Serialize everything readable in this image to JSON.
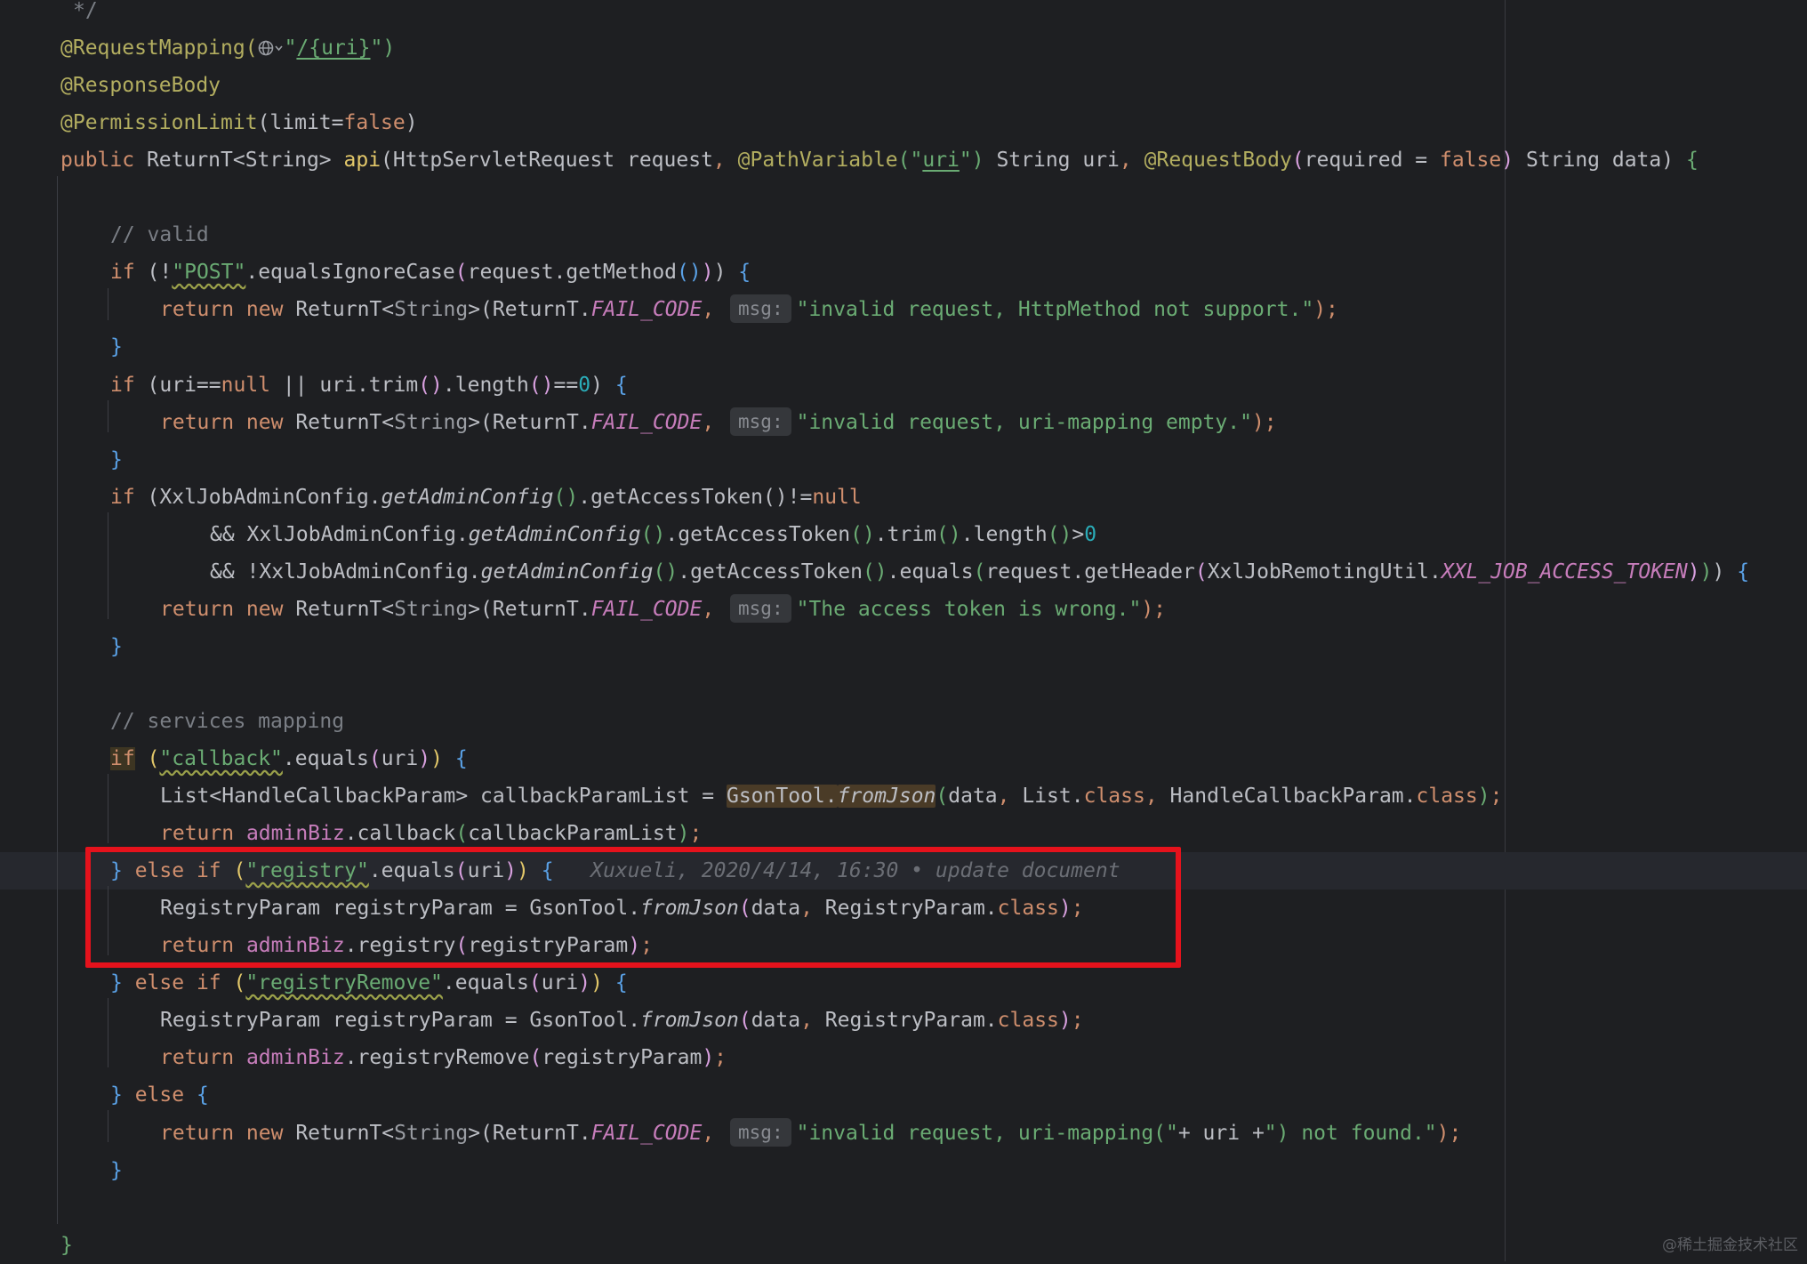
{
  "editor": {
    "lines": [
      [
        {
          "t": "*/",
          "c": "t-cm"
        }
      ],
      [
        {
          "t": "@RequestMapping(",
          "c": "t-ann"
        },
        {
          "icon": "globe"
        },
        {
          "t": "\"",
          "c": "t-str"
        },
        {
          "t": "/{uri}",
          "c": "t-str t-link"
        },
        {
          "t": "\")",
          "c": "t-str"
        }
      ],
      [
        {
          "t": "@ResponseBody",
          "c": "t-ann"
        }
      ],
      [
        {
          "t": "@PermissionLimit",
          "c": "t-ann"
        },
        {
          "t": "(limit="
        },
        {
          "t": "false",
          "c": "t-kw"
        },
        {
          "t": ")"
        }
      ],
      [
        {
          "t": "public ",
          "c": "t-kw"
        },
        {
          "t": "ReturnT<String> "
        },
        {
          "t": "api",
          "c": "t-p1"
        },
        {
          "t": "(HttpServletRequest request"
        },
        {
          "t": ", ",
          "c": "t-kw"
        },
        {
          "t": "@PathVariable",
          "c": "t-ann"
        },
        {
          "t": "(\"",
          "c": "t-str"
        },
        {
          "t": "uri",
          "c": "t-str t-link"
        },
        {
          "t": "\") ",
          "c": "t-str"
        },
        {
          "t": "String uri"
        },
        {
          "t": ", ",
          "c": "t-kw"
        },
        {
          "t": "@RequestBody",
          "c": "t-ann"
        },
        {
          "t": "(",
          "c": "t-p2"
        },
        {
          "t": "required = "
        },
        {
          "t": "false",
          "c": "t-kw"
        },
        {
          "t": ") ",
          "c": "t-p2"
        },
        {
          "t": "String data) "
        },
        {
          "t": "{",
          "c": "t-str"
        }
      ],
      [],
      [
        {
          "t": "// valid",
          "c": "t-cm"
        }
      ],
      [
        {
          "t": "if ",
          "c": "t-kw"
        },
        {
          "t": "(!"
        },
        {
          "t": "\"POST\"",
          "c": "t-str t-warn"
        },
        {
          "t": ".equalsIgnoreCase"
        },
        {
          "t": "(",
          "c": "t-p2"
        },
        {
          "t": "request.getMethod"
        },
        {
          "t": "()",
          "c": "t-p3"
        },
        {
          "t": ")",
          "c": "t-p2"
        },
        {
          "t": ") "
        },
        {
          "t": "{",
          "c": "t-p3"
        }
      ],
      [
        {
          "t": "return new ",
          "c": "t-kw"
        },
        {
          "t": "ReturnT<"
        },
        {
          "t": "String",
          "c": "t-gen"
        },
        {
          "t": ">(ReturnT."
        },
        {
          "t": "FAIL_CODE",
          "c": "t-fld"
        },
        {
          "t": ", ",
          "c": "t-kw"
        },
        {
          "hint": "msg:"
        },
        {
          "t": "\"invalid request, HttpMethod not support.\"",
          "c": "t-str"
        },
        {
          "t": ");",
          "c": "t-kw"
        }
      ],
      [
        {
          "t": "}",
          "c": "t-p3"
        }
      ],
      [
        {
          "t": "if ",
          "c": "t-kw"
        },
        {
          "t": "(uri=="
        },
        {
          "t": "null",
          "c": "t-kw"
        },
        {
          "t": " || uri.trim"
        },
        {
          "t": "()",
          "c": "t-p2"
        },
        {
          "t": ".length"
        },
        {
          "t": "()",
          "c": "t-p2"
        },
        {
          "t": "=="
        },
        {
          "t": "0",
          "c": "t-num"
        },
        {
          "t": ") "
        },
        {
          "t": "{",
          "c": "t-p3"
        }
      ],
      [
        {
          "t": "return new ",
          "c": "t-kw"
        },
        {
          "t": "ReturnT<"
        },
        {
          "t": "String",
          "c": "t-gen"
        },
        {
          "t": ">(ReturnT."
        },
        {
          "t": "FAIL_CODE",
          "c": "t-fld"
        },
        {
          "t": ", ",
          "c": "t-kw"
        },
        {
          "hint": "msg:"
        },
        {
          "t": "\"invalid request, uri-mapping empty.\"",
          "c": "t-str"
        },
        {
          "t": ");",
          "c": "t-kw"
        }
      ],
      [
        {
          "t": "}",
          "c": "t-p3"
        }
      ],
      [
        {
          "t": "if ",
          "c": "t-kw"
        },
        {
          "t": "(XxlJobAdminConfig."
        },
        {
          "t": "getAdminConfig",
          "c": "t-st"
        },
        {
          "t": "()",
          "c": "t-str"
        },
        {
          "t": ".getAccessToken()!="
        },
        {
          "t": "null",
          "c": "t-kw"
        }
      ],
      [
        {
          "t": "&& XxlJobAdminConfig."
        },
        {
          "t": "getAdminConfig",
          "c": "t-st"
        },
        {
          "t": "()",
          "c": "t-str"
        },
        {
          "t": ".getAccessToken"
        },
        {
          "t": "()",
          "c": "t-str"
        },
        {
          "t": ".trim"
        },
        {
          "t": "()",
          "c": "t-str"
        },
        {
          "t": ".length"
        },
        {
          "t": "()",
          "c": "t-str"
        },
        {
          "t": ">"
        },
        {
          "t": "0",
          "c": "t-num"
        }
      ],
      [
        {
          "t": "&& !XxlJobAdminConfig."
        },
        {
          "t": "getAdminConfig",
          "c": "t-st"
        },
        {
          "t": "()",
          "c": "t-str"
        },
        {
          "t": ".getAccessToken"
        },
        {
          "t": "()",
          "c": "t-str"
        },
        {
          "t": ".equals"
        },
        {
          "t": "(",
          "c": "t-str"
        },
        {
          "t": "request.getHeader"
        },
        {
          "t": "(",
          "c": "t-p2"
        },
        {
          "t": "XxlJobRemotingUtil."
        },
        {
          "t": "XXL_JOB_ACCESS_TOKEN",
          "c": "t-fld"
        },
        {
          "t": ")",
          "c": "t-p2"
        },
        {
          "t": ")",
          "c": "t-str"
        },
        {
          "t": ") "
        },
        {
          "t": "{",
          "c": "t-p3"
        }
      ],
      [
        {
          "t": "return new ",
          "c": "t-kw"
        },
        {
          "t": "ReturnT<"
        },
        {
          "t": "String",
          "c": "t-gen"
        },
        {
          "t": ">(ReturnT."
        },
        {
          "t": "FAIL_CODE",
          "c": "t-fld"
        },
        {
          "t": ", ",
          "c": "t-kw"
        },
        {
          "hint": "msg:"
        },
        {
          "t": "\"The access token is wrong.\"",
          "c": "t-str"
        },
        {
          "t": ");",
          "c": "t-kw"
        }
      ],
      [
        {
          "t": "}",
          "c": "t-p3"
        }
      ],
      [],
      [
        {
          "t": "// services mapping",
          "c": "t-cm"
        }
      ],
      [
        {
          "t": "if",
          "c": "t-kw t-hl2"
        },
        {
          "t": " "
        },
        {
          "t": "(",
          "c": "t-p1"
        },
        {
          "t": "\"callback\"",
          "c": "t-str t-warn"
        },
        {
          "t": ".equals"
        },
        {
          "t": "(",
          "c": "t-p2"
        },
        {
          "t": "uri"
        },
        {
          "t": ")",
          "c": "t-p2"
        },
        {
          "t": ") ",
          "c": "t-p1"
        },
        {
          "t": "{",
          "c": "t-p3"
        }
      ],
      [
        {
          "t": "List<HandleCallbackParam> callbackParamList = "
        },
        {
          "t": "GsonTool.",
          "c": "t-hl"
        },
        {
          "t": "fromJson",
          "c": "t-st t-hl"
        },
        {
          "t": "(",
          "c": "t-str"
        },
        {
          "t": "data"
        },
        {
          "t": ", ",
          "c": "t-kw"
        },
        {
          "t": "List."
        },
        {
          "t": "class",
          "c": "t-kw"
        },
        {
          "t": ", ",
          "c": "t-kw"
        },
        {
          "t": "HandleCallbackParam."
        },
        {
          "t": "class",
          "c": "t-kw"
        },
        {
          "t": ")",
          "c": "t-str"
        },
        {
          "t": ";",
          "c": "t-kw"
        }
      ],
      [
        {
          "t": "return ",
          "c": "t-kw"
        },
        {
          "t": "adminBiz",
          "c": "t-ifld"
        },
        {
          "t": ".callback"
        },
        {
          "t": "(",
          "c": "t-str"
        },
        {
          "t": "callbackParamList"
        },
        {
          "t": ")",
          "c": "t-str"
        },
        {
          "t": ";",
          "c": "t-kw"
        }
      ],
      [
        {
          "t": "} ",
          "c": "t-p3"
        },
        {
          "t": "else if ",
          "c": "t-kw"
        },
        {
          "t": "(",
          "c": "t-p1"
        },
        {
          "t": "\"registry\"",
          "c": "t-str t-warn"
        },
        {
          "t": ".equals"
        },
        {
          "t": "(",
          "c": "t-p2"
        },
        {
          "t": "uri"
        },
        {
          "t": ")",
          "c": "t-p2"
        },
        {
          "t": ") ",
          "c": "t-p1"
        },
        {
          "t": "{",
          "c": "t-p3"
        },
        {
          "t": "   "
        },
        {
          "t": "Xuxueli, 2020/4/14, 16:30 • update document",
          "c": "blame"
        }
      ],
      [
        {
          "t": "RegistryParam registryParam = GsonTool."
        },
        {
          "t": "fromJson",
          "c": "t-st"
        },
        {
          "t": "(",
          "c": "t-p2"
        },
        {
          "t": "data"
        },
        {
          "t": ", ",
          "c": "t-kw"
        },
        {
          "t": "RegistryParam."
        },
        {
          "t": "class",
          "c": "t-kw"
        },
        {
          "t": ")",
          "c": "t-p2"
        },
        {
          "t": ";",
          "c": "t-kw"
        }
      ],
      [
        {
          "t": "return ",
          "c": "t-kw"
        },
        {
          "t": "adminBiz",
          "c": "t-ifld"
        },
        {
          "t": ".registry"
        },
        {
          "t": "(",
          "c": "t-p2"
        },
        {
          "t": "registryParam"
        },
        {
          "t": ")",
          "c": "t-p2"
        },
        {
          "t": ";",
          "c": "t-kw"
        }
      ],
      [
        {
          "t": "} ",
          "c": "t-p3"
        },
        {
          "t": "else if ",
          "c": "t-kw"
        },
        {
          "t": "(",
          "c": "t-p1"
        },
        {
          "t": "\"registryRemove\"",
          "c": "t-str t-warn"
        },
        {
          "t": ".equals"
        },
        {
          "t": "(",
          "c": "t-p2"
        },
        {
          "t": "uri"
        },
        {
          "t": ")",
          "c": "t-p2"
        },
        {
          "t": ") ",
          "c": "t-p1"
        },
        {
          "t": "{",
          "c": "t-p3"
        }
      ],
      [
        {
          "t": "RegistryParam registryParam = GsonTool."
        },
        {
          "t": "fromJson",
          "c": "t-st"
        },
        {
          "t": "(",
          "c": "t-p2"
        },
        {
          "t": "data"
        },
        {
          "t": ", ",
          "c": "t-kw"
        },
        {
          "t": "RegistryParam."
        },
        {
          "t": "class",
          "c": "t-kw"
        },
        {
          "t": ")",
          "c": "t-p2"
        },
        {
          "t": ";",
          "c": "t-kw"
        }
      ],
      [
        {
          "t": "return ",
          "c": "t-kw"
        },
        {
          "t": "adminBiz",
          "c": "t-ifld"
        },
        {
          "t": ".registryRemove"
        },
        {
          "t": "(",
          "c": "t-p2"
        },
        {
          "t": "registryParam"
        },
        {
          "t": ")",
          "c": "t-p2"
        },
        {
          "t": ";",
          "c": "t-kw"
        }
      ],
      [
        {
          "t": "} ",
          "c": "t-p3"
        },
        {
          "t": "else ",
          "c": "t-kw"
        },
        {
          "t": "{",
          "c": "t-p3"
        }
      ],
      [
        {
          "t": "return new ",
          "c": "t-kw"
        },
        {
          "t": "ReturnT<"
        },
        {
          "t": "String",
          "c": "t-gen"
        },
        {
          "t": ">(ReturnT."
        },
        {
          "t": "FAIL_CODE",
          "c": "t-fld"
        },
        {
          "t": ", ",
          "c": "t-kw"
        },
        {
          "hint": "msg:"
        },
        {
          "t": "\"invalid request, uri-mapping(\"",
          "c": "t-str"
        },
        {
          "t": "+ uri +"
        },
        {
          "t": "\") not found.\"",
          "c": "t-str"
        },
        {
          "t": ");",
          "c": "t-kw"
        }
      ],
      [
        {
          "t": "}",
          "c": "t-p3"
        }
      ],
      [],
      [
        {
          "t": "}",
          "c": "t-str"
        }
      ]
    ],
    "current_line": 23
  },
  "watermark": "@稀土掘金技术社区",
  "colors": {
    "background": "#1e1f22",
    "keyword": "#cf8e6d",
    "string": "#6aab73",
    "annotation": "#b3ae60",
    "comment": "#7a7e85",
    "number": "#2aacb8",
    "field": "#c77dbb",
    "highlight_box": "#e5121c"
  }
}
